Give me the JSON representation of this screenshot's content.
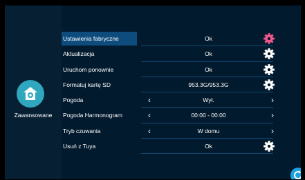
{
  "sidebar": {
    "category_label": "Zawansowane",
    "category_icon": "home-gear-icon"
  },
  "menu": [
    {
      "label": "Ustawienia fabryczne",
      "value": "Ok",
      "control": "gear",
      "gear_color": "#f0588e",
      "selected": true
    },
    {
      "label": "Aktualizacja",
      "value": "Ok",
      "control": "gear",
      "gear_color": "#ffffff"
    },
    {
      "label": "Uruchom ponownie",
      "value": "Ok",
      "control": "gear",
      "gear_color": "#ffffff"
    },
    {
      "label": "Formatuj kartę SD",
      "value": "953.3G/953.3G",
      "control": "gear",
      "gear_color": "#ffffff"
    },
    {
      "label": "Pogoda",
      "value": "Wył.",
      "control": "arrows"
    },
    {
      "label": "Pogoda Harmonogram",
      "value": "00:00 - 00:00",
      "control": "arrows"
    },
    {
      "label": "Tryb czuwania",
      "value": "W domu",
      "control": "arrows"
    },
    {
      "label": "Usuń z Tuya",
      "value": "Ok",
      "control": "gear",
      "gear_color": "#ffffff"
    }
  ],
  "colors": {
    "accent": "#2fa7bf",
    "selected_row": "#0e4c7d",
    "background": "#021a2d"
  },
  "corner_button_icon": "refresh-icon"
}
